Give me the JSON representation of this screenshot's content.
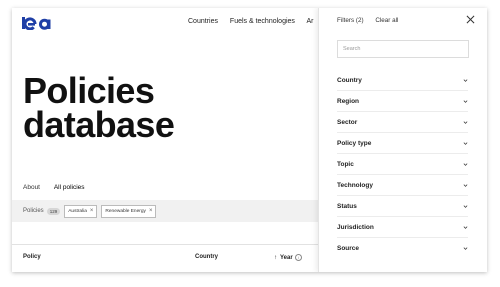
{
  "header": {
    "logo": "iea",
    "nav": [
      "Countries",
      "Fuels & technologies",
      "Ar"
    ]
  },
  "hero": {
    "line1": "Policies",
    "line2": "database"
  },
  "tabs": [
    {
      "label": "About",
      "active": false
    },
    {
      "label": "All policies",
      "active": true
    }
  ],
  "filter_bar": {
    "label": "Policies",
    "count": "129",
    "chips": [
      "Australia",
      "Renewable Energy"
    ]
  },
  "table": {
    "columns": [
      "Policy",
      "Country",
      "Year"
    ],
    "year_sort_icon": "up-arrow",
    "info_icon": "i"
  },
  "panel": {
    "filters_label": "Filters (2)",
    "clear_label": "Clear all",
    "search_placeholder": "Search",
    "items": [
      "Country",
      "Region",
      "Sector",
      "Policy type",
      "Topic",
      "Technology",
      "Status",
      "Jurisdiction",
      "Source"
    ]
  },
  "colors": {
    "brand": "#1F3FA6",
    "chip_bar": "#F1F1F1",
    "text": "#1A1A1A"
  }
}
